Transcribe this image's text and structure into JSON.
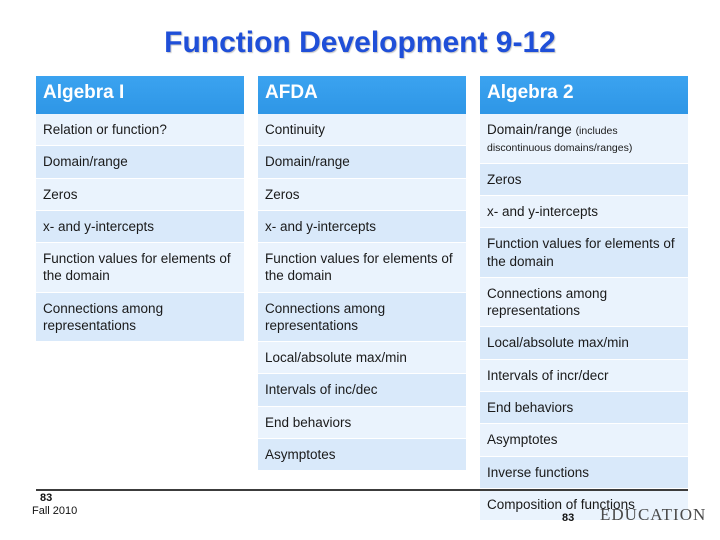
{
  "slide": {
    "title": "Function Development 9-12"
  },
  "columns": [
    {
      "header": "Algebra I",
      "rows": [
        {
          "text": "Relation or function?"
        },
        {
          "text": "Domain/range"
        },
        {
          "text": "Zeros"
        },
        {
          "text": "x- and y-intercepts"
        },
        {
          "text": "Function values for elements of the domain"
        },
        {
          "text": "Connections among representations"
        }
      ]
    },
    {
      "header": "AFDA",
      "rows": [
        {
          "text": "Continuity"
        },
        {
          "text": "Domain/range"
        },
        {
          "text": "Zeros"
        },
        {
          "text": "x- and y-intercepts"
        },
        {
          "text": "Function values for elements of the domain"
        },
        {
          "text": "Connections among representations"
        },
        {
          "text": "Local/absolute max/min"
        },
        {
          "text": "Intervals of inc/dec"
        },
        {
          "text": "End behaviors"
        },
        {
          "text": "Asymptotes"
        }
      ]
    },
    {
      "header": "Algebra 2",
      "rows": [
        {
          "text": "Domain/range",
          "note": "(includes discontinuous domains/ranges)"
        },
        {
          "text": "Zeros"
        },
        {
          "text": "x- and y-intercepts"
        },
        {
          "text": "Function values for elements of the domain"
        },
        {
          "text": "Connections among representations"
        },
        {
          "text": "Local/absolute max/min"
        },
        {
          "text": "Intervals of incr/decr"
        },
        {
          "text": "End behaviors"
        },
        {
          "text": "Asymptotes"
        },
        {
          "text": "Inverse functions"
        },
        {
          "text": "Composition of functions"
        }
      ]
    }
  ],
  "footer": {
    "page_number_left": "83",
    "date": "Fall 2010",
    "page_number_right": "83",
    "brand": "EDUCATION"
  },
  "colors": {
    "title": "#1f4fd8",
    "header_bg": "#3aa0ee",
    "row_light": "#eaf3fd",
    "row_dark": "#d9e9fa"
  }
}
